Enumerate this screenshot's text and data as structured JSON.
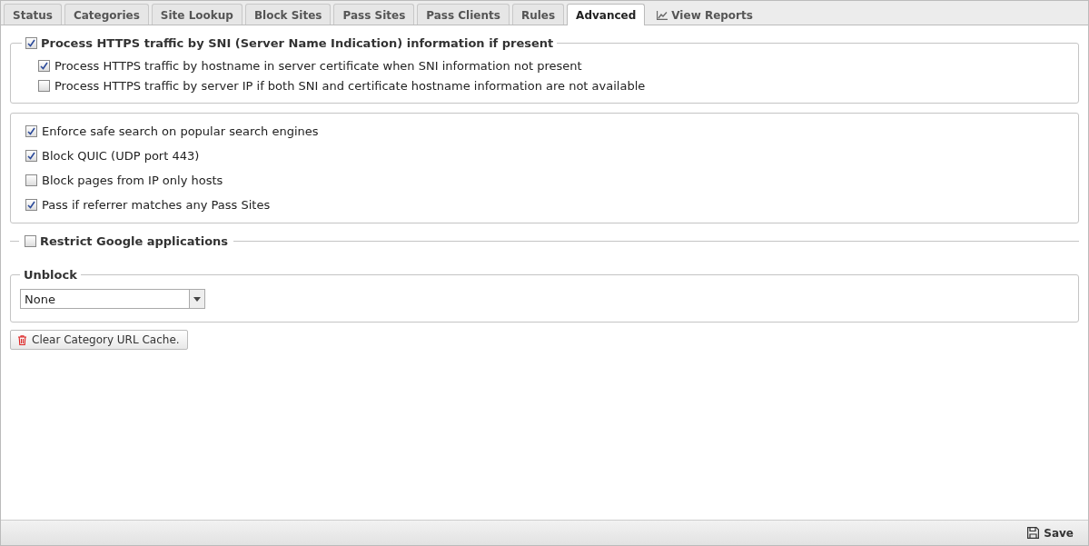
{
  "tabs": [
    {
      "label": "Status",
      "selected": false,
      "kind": "tab"
    },
    {
      "label": "Categories",
      "selected": false,
      "kind": "tab"
    },
    {
      "label": "Site Lookup",
      "selected": false,
      "kind": "tab"
    },
    {
      "label": "Block Sites",
      "selected": false,
      "kind": "tab"
    },
    {
      "label": "Pass Sites",
      "selected": false,
      "kind": "tab"
    },
    {
      "label": "Pass Clients",
      "selected": false,
      "kind": "tab"
    },
    {
      "label": "Rules",
      "selected": false,
      "kind": "tab"
    },
    {
      "label": "Advanced",
      "selected": true,
      "kind": "tab"
    },
    {
      "label": "View Reports",
      "selected": false,
      "kind": "report"
    }
  ],
  "sni_group": {
    "label": "Process HTTPS traffic by SNI (Server Name Indication) information if present",
    "checked": true,
    "options": [
      {
        "label": "Process HTTPS traffic by hostname in server certificate when SNI information not present",
        "checked": true
      },
      {
        "label": "Process HTTPS traffic by server IP if both SNI and certificate hostname information are not available",
        "checked": false
      }
    ]
  },
  "options": [
    {
      "label": "Enforce safe search on popular search engines",
      "checked": true
    },
    {
      "label": "Block QUIC (UDP port 443)",
      "checked": true
    },
    {
      "label": "Block pages from IP only hosts",
      "checked": false
    },
    {
      "label": "Pass if referrer matches any Pass Sites",
      "checked": true
    }
  ],
  "google_group": {
    "label": "Restrict Google applications",
    "checked": false
  },
  "unblock": {
    "legend": "Unblock",
    "value": "None"
  },
  "clear_button": "Clear Category URL Cache.",
  "save_button": "Save"
}
